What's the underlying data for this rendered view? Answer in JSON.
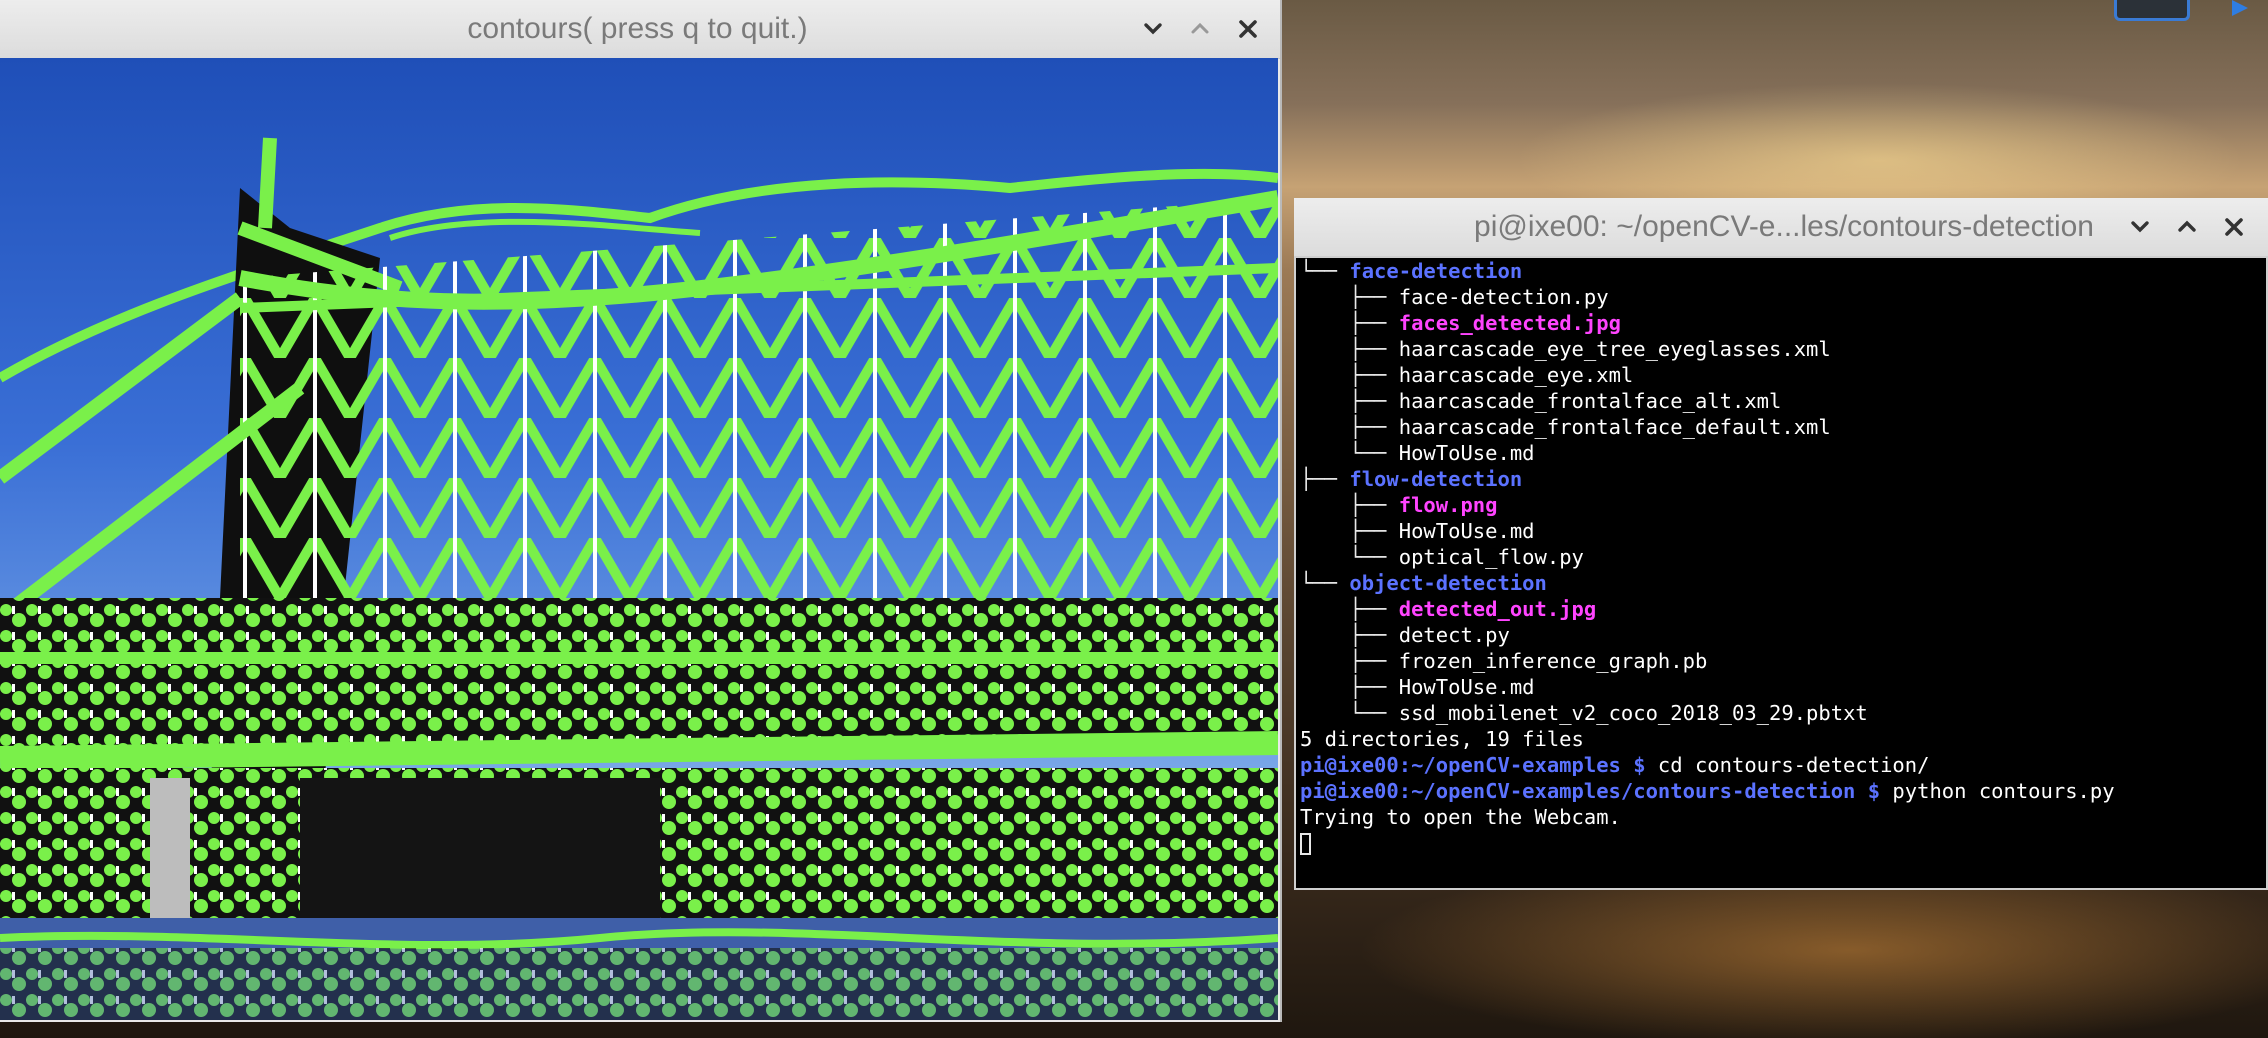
{
  "image_window": {
    "title": "contours( press q to quit.)"
  },
  "terminal_window": {
    "title": "pi@ixe00: ~/openCV-e...les/contours-detection",
    "lines": [
      {
        "tree": "└── ",
        "text": "face-detection",
        "kind": "dir"
      },
      {
        "tree": "    ├── ",
        "text": "face-detection.py",
        "kind": "file"
      },
      {
        "tree": "    ├── ",
        "text": "faces_detected.jpg",
        "kind": "img"
      },
      {
        "tree": "    ├── ",
        "text": "haarcascade_eye_tree_eyeglasses.xml",
        "kind": "file"
      },
      {
        "tree": "    ├── ",
        "text": "haarcascade_eye.xml",
        "kind": "file"
      },
      {
        "tree": "    ├── ",
        "text": "haarcascade_frontalface_alt.xml",
        "kind": "file"
      },
      {
        "tree": "    ├── ",
        "text": "haarcascade_frontalface_default.xml",
        "kind": "file"
      },
      {
        "tree": "    └── ",
        "text": "HowToUse.md",
        "kind": "file"
      },
      {
        "tree": "├── ",
        "text": "flow-detection",
        "kind": "dir"
      },
      {
        "tree": "    ├── ",
        "text": "flow.png",
        "kind": "img"
      },
      {
        "tree": "    ├── ",
        "text": "HowToUse.md",
        "kind": "file"
      },
      {
        "tree": "    └── ",
        "text": "optical_flow.py",
        "kind": "file"
      },
      {
        "tree": "└── ",
        "text": "object-detection",
        "kind": "dir"
      },
      {
        "tree": "    ├── ",
        "text": "detected_out.jpg",
        "kind": "img"
      },
      {
        "tree": "    ├── ",
        "text": "detect.py",
        "kind": "file"
      },
      {
        "tree": "    ├── ",
        "text": "frozen_inference_graph.pb",
        "kind": "file"
      },
      {
        "tree": "    ├── ",
        "text": "HowToUse.md",
        "kind": "file"
      },
      {
        "tree": "    └── ",
        "text": "ssd_mobilenet_v2_coco_2018_03_29.pbtxt",
        "kind": "file"
      }
    ],
    "summary": "5 directories, 19 files",
    "cmd1_prompt": "pi@ixe00:~/openCV-examples $ ",
    "cmd1": "cd contours-detection/",
    "cmd2_prompt": "pi@ixe00:~/openCV-examples/contours-detection $ ",
    "cmd2": "python contours.py",
    "output": "Trying to open the Webcam."
  },
  "colors": {
    "contour_green": "#7af04a",
    "sky_blue": "#3a6fd6",
    "terminal_bg": "#000000",
    "dir_blue": "#5b72ff",
    "image_magenta": "#ff44ff"
  },
  "icons": [
    "chevron-down-icon",
    "chevron-up-icon",
    "close-icon"
  ]
}
